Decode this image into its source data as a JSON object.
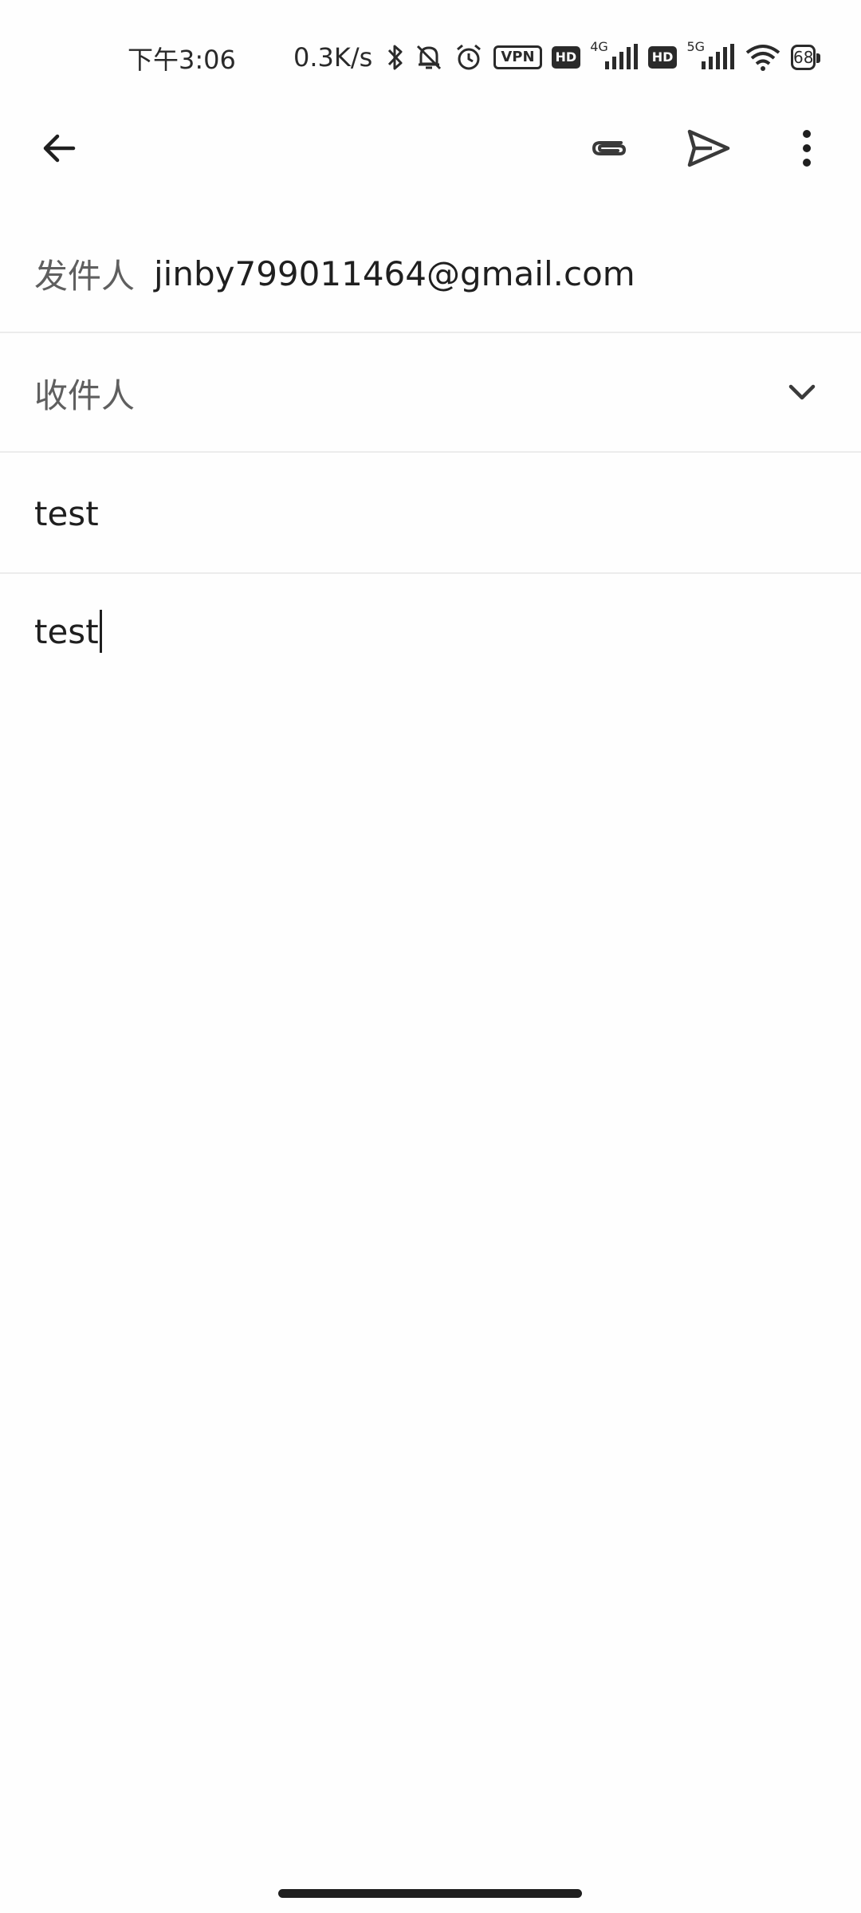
{
  "status_bar": {
    "time": "下午3:06",
    "network_speed": "0.3K/s",
    "vpn_label": "VPN",
    "hd_label": "HD",
    "sim1_network": "4G",
    "sim2_network": "5G",
    "battery_level": "68",
    "icons": [
      "bluetooth-icon",
      "mute-bell-icon",
      "alarm-icon",
      "vpn-icon",
      "hd-icon",
      "signal-icon",
      "wifi-icon",
      "battery-icon"
    ]
  },
  "toolbar": {
    "back_icon": "arrow-back-icon",
    "attach_icon": "paperclip-icon",
    "send_icon": "send-icon",
    "more_icon": "more-vert-icon"
  },
  "compose": {
    "from_label": "发件人",
    "from_value": "jinby799011464@gmail.com",
    "to_label": "收件人",
    "to_expand_icon": "chevron-down-icon",
    "subject": "test",
    "body": "test"
  }
}
